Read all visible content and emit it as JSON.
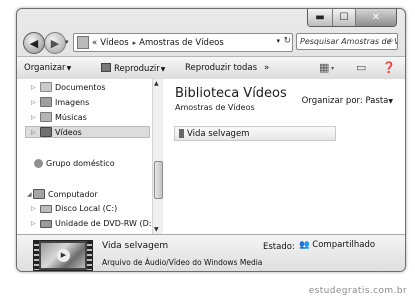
{
  "window": {
    "caption": {
      "minimize": "▬",
      "maximize": "☐",
      "close": "✕"
    }
  },
  "address": {
    "back": "◀",
    "forward": "▶",
    "recent": "▾",
    "prefix": "«",
    "parts": [
      "Vídeos",
      "Amostras de Vídeos"
    ],
    "separator": "▸",
    "refresh": "↻",
    "search_placeholder": "Pesquisar Amostras de Ví..."
  },
  "toolbar": {
    "organize": "Organizar",
    "share": "Reproduzir",
    "play_all": "Reproduzir todas",
    "more": "»"
  },
  "nav": {
    "items": [
      {
        "label": "Documentos",
        "icon": "documents-icon"
      },
      {
        "label": "Imagens",
        "icon": "pictures-icon"
      },
      {
        "label": "Músicas",
        "icon": "music-icon"
      },
      {
        "label": "Vídeos",
        "icon": "videos-icon",
        "selected": true
      },
      {
        "label": "Grupo doméstico",
        "icon": "homegroup-icon"
      },
      {
        "label": "Computador",
        "icon": "computer-icon"
      },
      {
        "label": "Disco Local (C:)",
        "icon": "drive-icon"
      },
      {
        "label": "Unidade de DVD-RW (D:)",
        "icon": "dvd-drive-icon"
      }
    ]
  },
  "content": {
    "title": "Biblioteca Vídeos",
    "subtitle": "Amostras de Vídeos",
    "arrange_label": "Organizar por:",
    "arrange_value": "Pasta",
    "files": [
      {
        "name": "Vida selvagem"
      }
    ]
  },
  "details": {
    "name": "Vida selvagem",
    "type": "Arquivo de Áudio/Vídeo do Windows Media",
    "state_label": "Estado:",
    "state_value": "Compartilhado"
  },
  "watermark": "estudegratis.com.br"
}
